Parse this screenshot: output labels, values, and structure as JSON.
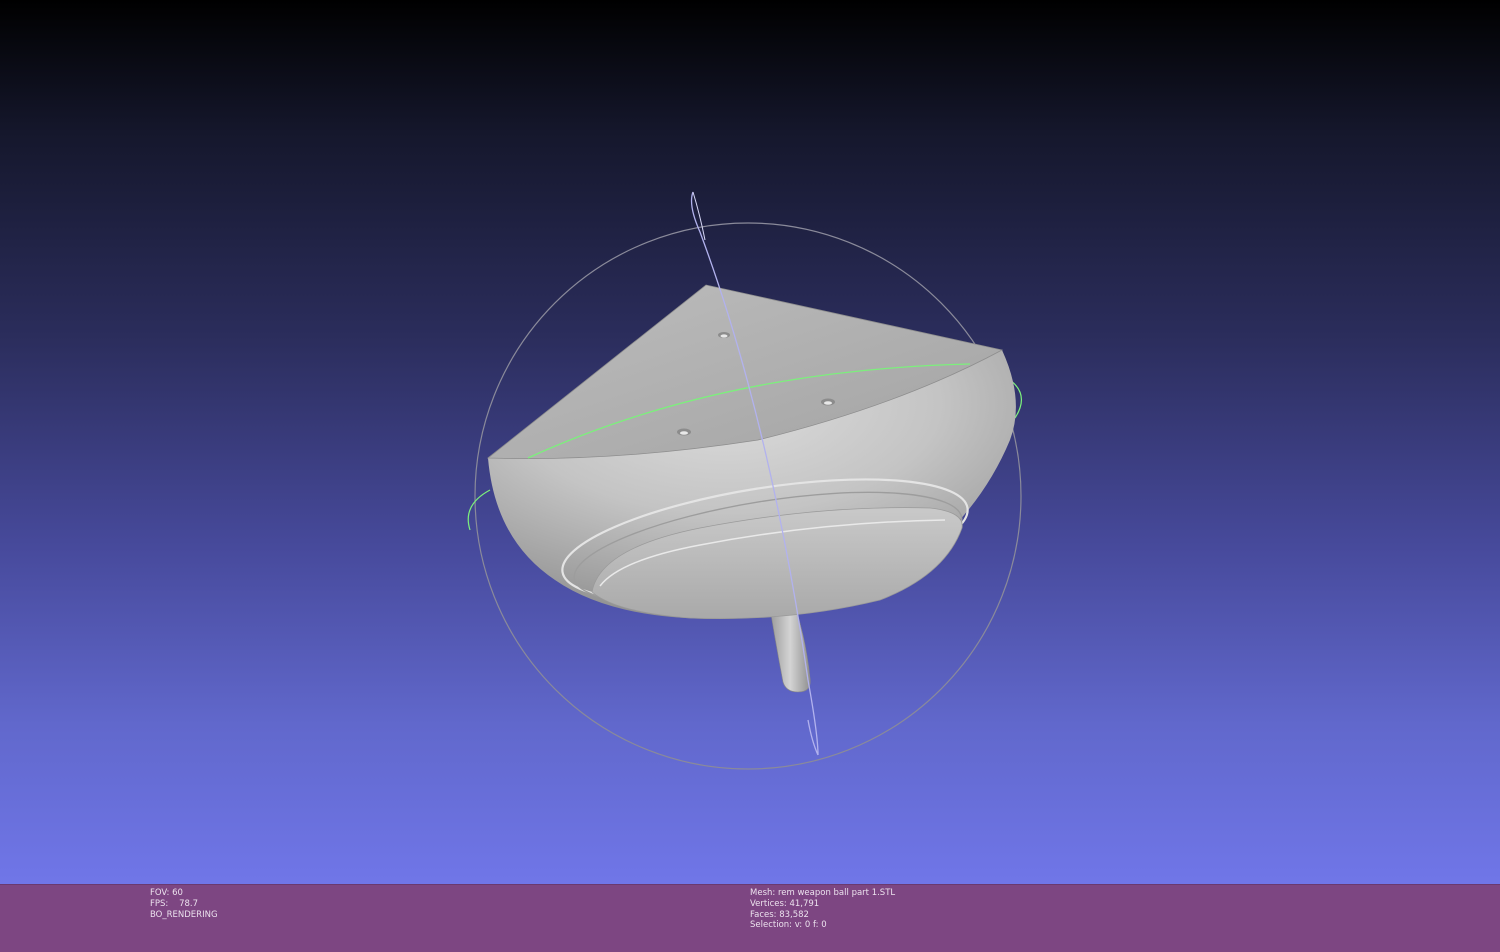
{
  "viewport": {
    "model_name": "rem weapon ball part 1.STL",
    "trackball_colors": {
      "horizontal_ring": "#7cf07c",
      "vertical_ring": "#b2b2ee",
      "outer_ring": "#8a8a9a"
    },
    "background": {
      "top": "#000000",
      "bottom": "#7076e8"
    }
  },
  "statusbar": {
    "background": "#7d4682",
    "left": {
      "fov": "FOV: 60",
      "fps": "FPS:    78.7",
      "mode": "BO_RENDERING"
    },
    "right": {
      "mesh": "Mesh: rem weapon ball part 1.STL",
      "vertices": "Vertices: 41,791",
      "faces": "Faces: 83,582",
      "selection": "Selection: v: 0 f: 0"
    }
  }
}
